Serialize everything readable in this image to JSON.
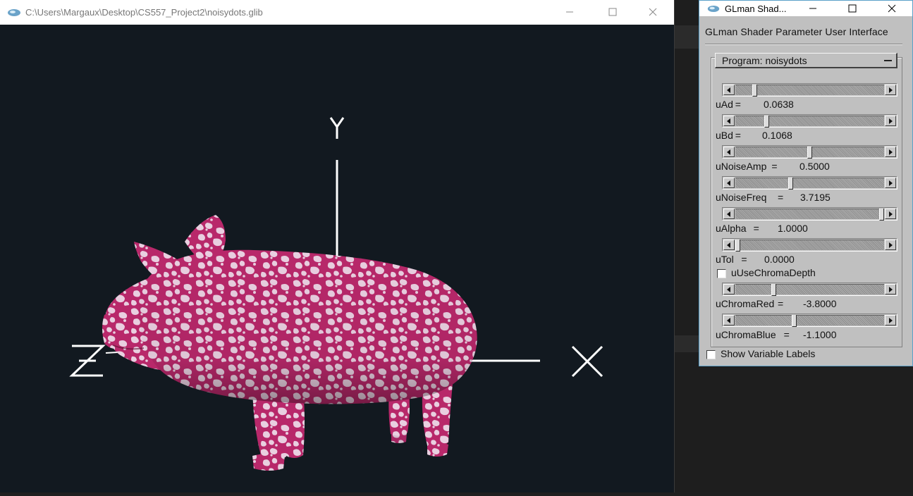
{
  "render_window": {
    "title": "C:\\Users\\Margaux\\Desktop\\CS557_Project2\\noisydots.glib",
    "axes": {
      "y": "Y",
      "z": "Z",
      "x": "X"
    }
  },
  "param_window": {
    "title": "GLman Shad...",
    "heading": "GLman Shader Parameter User Interface",
    "program_label": "Program: noisydots",
    "params": [
      {
        "name": "uAd",
        "value": "0.0638",
        "fraction": 0.12
      },
      {
        "name": "uBd",
        "value": "0.1068",
        "fraction": 0.2
      },
      {
        "name": "uNoiseAmp",
        "value": "0.5000",
        "fraction": 0.5
      },
      {
        "name": "uNoiseFreq",
        "value": "3.7195",
        "fraction": 0.37
      },
      {
        "name": "uAlpha",
        "value": "1.0000",
        "fraction": 1.0
      },
      {
        "name": "uTol",
        "value": "0.0000",
        "fraction": 0.0
      }
    ],
    "use_chroma_depth": {
      "label": "uUseChromaDepth",
      "checked": false
    },
    "chroma_params": [
      {
        "name": "uChromaRed",
        "value": "-3.8000",
        "fraction": 0.25
      },
      {
        "name": "uChromaBlue",
        "value": "-1.1000",
        "fraction": 0.39
      }
    ],
    "show_variable_labels": {
      "label": "Show Variable Labels",
      "checked": false
    }
  },
  "colors": {
    "viewport_bg": "#121920",
    "pig_pink": "#b8286a",
    "pig_light": "#e9cfe0",
    "axis_white": "#ffffff",
    "panel_gray": "#c0c0c0"
  },
  "icons": [
    "glman-app-icon",
    "minimize-icon",
    "maximize-icon",
    "close-icon",
    "arrow-left-icon",
    "arrow-right-icon",
    "collapse-icon"
  ]
}
